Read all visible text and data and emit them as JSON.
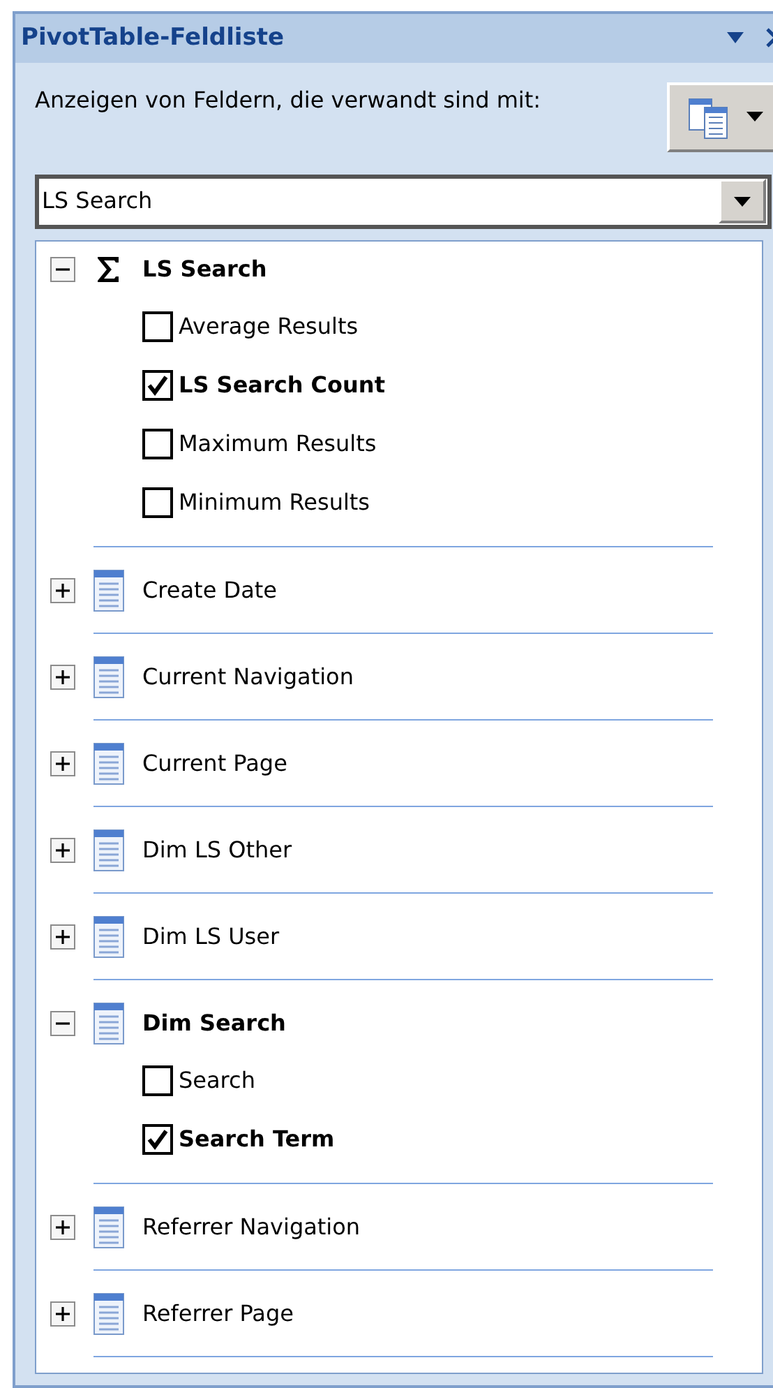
{
  "title": "PivotTable-Feldliste",
  "related_label": "Anzeigen von Feldern, die verwandt sind mit:",
  "related_select": {
    "value": "LS Search"
  },
  "groups": [
    {
      "kind": "measure",
      "label": "LS Search",
      "expanded": true,
      "fields": [
        {
          "label": "Average Results",
          "checked": false
        },
        {
          "label": "LS Search Count",
          "checked": true
        },
        {
          "label": "Maximum Results",
          "checked": false
        },
        {
          "label": "Minimum Results",
          "checked": false
        }
      ]
    },
    {
      "kind": "dimension",
      "label": "Create Date",
      "expanded": false
    },
    {
      "kind": "dimension",
      "label": "Current Navigation",
      "expanded": false
    },
    {
      "kind": "dimension",
      "label": "Current Page",
      "expanded": false
    },
    {
      "kind": "dimension",
      "label": "Dim LS Other",
      "expanded": false
    },
    {
      "kind": "dimension",
      "label": "Dim LS User",
      "expanded": false
    },
    {
      "kind": "dimension",
      "label": "Dim Search",
      "expanded": true,
      "fields": [
        {
          "label": "Search",
          "checked": false
        },
        {
          "label": "Search Term",
          "checked": true
        }
      ]
    },
    {
      "kind": "dimension",
      "label": "Referrer Navigation",
      "expanded": false
    },
    {
      "kind": "dimension",
      "label": "Referrer Page",
      "expanded": false
    }
  ]
}
